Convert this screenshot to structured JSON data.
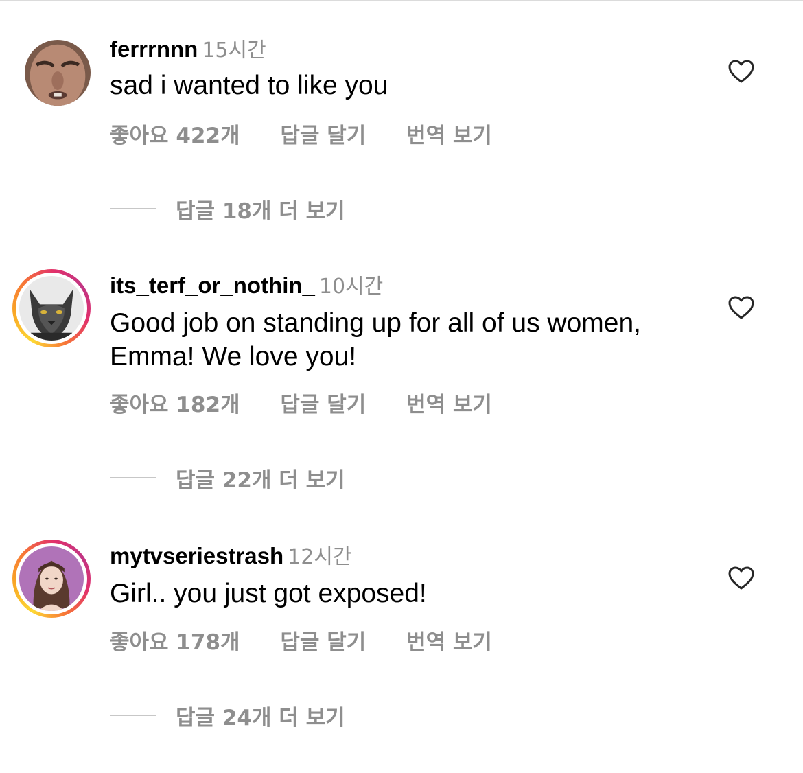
{
  "comments": [
    {
      "username": "ferrrnnn",
      "time": "15시간",
      "text": "sad i wanted to like you",
      "likes_label": "좋아요 422개",
      "reply_label": "답글 달기",
      "translate_label": "번역 보기",
      "view_replies_label": "답글 18개 더 보기",
      "has_story_ring": false
    },
    {
      "username": "its_terf_or_nothin_",
      "time": "10시간",
      "text": "Good job on standing up for all of us women, Emma! We love you!",
      "likes_label": "좋아요 182개",
      "reply_label": "답글 달기",
      "translate_label": "번역 보기",
      "view_replies_label": "답글 22개 더 보기",
      "has_story_ring": true
    },
    {
      "username": "mytvseriestrash",
      "time": "12시간",
      "text": "Girl.. you just got exposed!",
      "likes_label": "좋아요 178개",
      "reply_label": "답글 달기",
      "translate_label": "번역 보기",
      "view_replies_label": "답글 24개 더 보기",
      "has_story_ring": true
    }
  ],
  "icons": {
    "like": "heart-outline-icon"
  },
  "colors": {
    "primary_text": "#000000",
    "secondary_text": "#8e8e8e",
    "story_ring_start": "#fdd835",
    "story_ring_end": "#c13584"
  }
}
